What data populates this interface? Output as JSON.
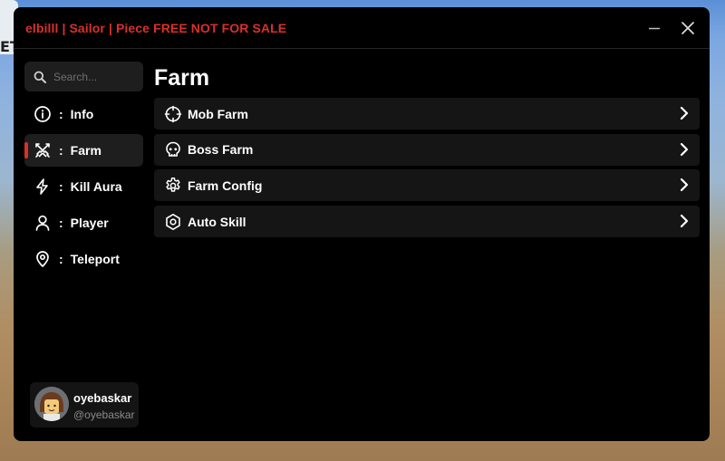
{
  "window": {
    "title": "elbilll | Sailor | Piece FREE NOT FOR SALE",
    "accent_color": "#d9302b",
    "controls": {
      "minimize_icon": "minimize-icon",
      "close_icon": "close-icon"
    }
  },
  "search": {
    "placeholder": "Search...",
    "value": "",
    "icon": "search-icon"
  },
  "sidebar": {
    "items": [
      {
        "label": "Info",
        "icon": "info-icon",
        "separator": ":",
        "active": false
      },
      {
        "label": "Farm",
        "icon": "crossed-swords-icon",
        "separator": ":",
        "active": true
      },
      {
        "label": "Kill Aura",
        "icon": "lightning-icon",
        "separator": ":",
        "active": false
      },
      {
        "label": "Player",
        "icon": "user-icon",
        "separator": ":",
        "active": false
      },
      {
        "label": "Teleport",
        "icon": "map-pin-icon",
        "separator": ":",
        "active": false
      }
    ]
  },
  "user": {
    "display_name": "oyebaskar",
    "handle": "@oyebaskar"
  },
  "main": {
    "title": "Farm",
    "sections": [
      {
        "label": "Mob Farm",
        "icon": "crosshair-icon"
      },
      {
        "label": "Boss Farm",
        "icon": "skull-icon"
      },
      {
        "label": "Farm Config",
        "icon": "gear-icon"
      },
      {
        "label": "Auto Skill",
        "icon": "hexagon-icon"
      }
    ]
  }
}
